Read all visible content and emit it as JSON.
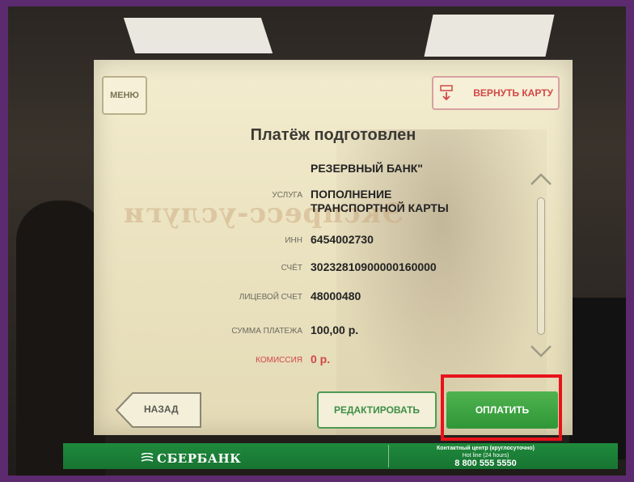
{
  "screen": {
    "menu_label": "МЕНЮ",
    "return_card_label": "ВЕРНУТЬ КАРТУ",
    "title": "Платёж подготовлен",
    "bank_name": "РЕЗЕРВНЫЙ БАНК\"",
    "service_label": "услуга",
    "service_value_line1": "ПОПОЛНЕНИЕ",
    "service_value_line2": "ТРАНСПОРТНОЙ КАРТЫ",
    "inn_label": "инн",
    "inn_value": "6454002730",
    "account_label": "счёт",
    "account_value": "30232810900000160000",
    "personal_account_label": "лицевой счет",
    "personal_account_value": "48000480",
    "amount_label": "сумма платежа",
    "amount_value": "100,00 р.",
    "commission_label": "комиссия",
    "commission_value": "0 р.",
    "back_label": "НАЗАД",
    "edit_label": "РЕДАКТИРОВАТЬ",
    "pay_label": "ОПЛАТИТЬ",
    "ghost_sign": "Экспресс-услуги"
  },
  "footer": {
    "brand": "СБЕРБАНК",
    "contact_line1": "Контактный центр (круглосуточно)",
    "contact_line2": "Hot line (24 hours)",
    "contact_phone": "8 800 555 5550"
  },
  "colors": {
    "accent_green": "#2f9637",
    "highlight_red": "#e8121b",
    "frame_purple": "#5c2a6e"
  }
}
